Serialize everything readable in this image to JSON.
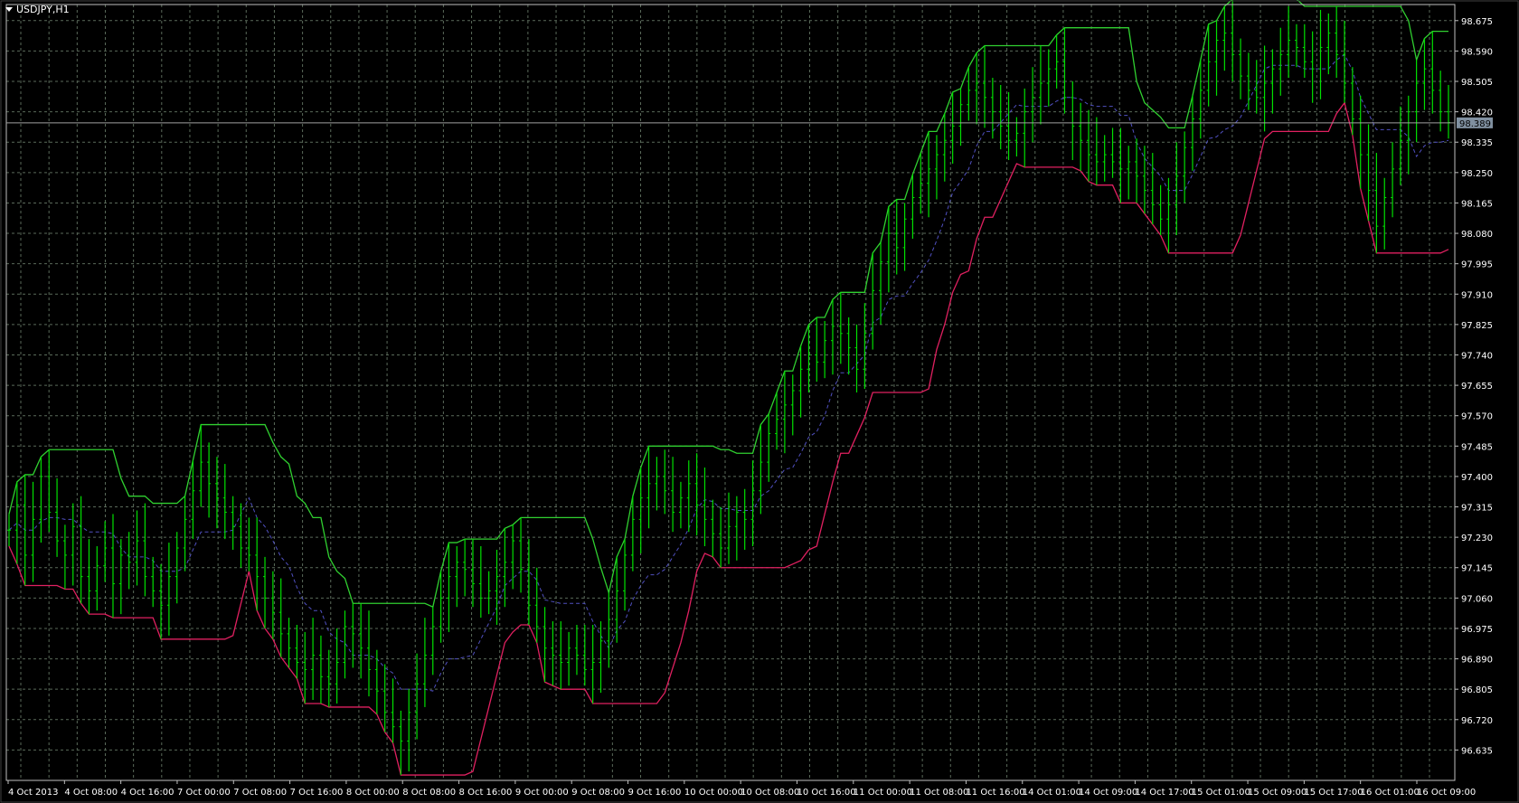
{
  "window": {
    "title": "USDJPY,H1"
  },
  "colors": {
    "background": "#000000",
    "grid": "#5a6a5a",
    "frame": "#c0c0c0",
    "bars": "#00e000",
    "upper_band": "#30d030",
    "lower_band": "#e02060",
    "middle_line": "#5050c0",
    "bid_line": "#a0a0a0",
    "price_tag_bg": "#8090a0"
  },
  "chart_data": {
    "type": "ohlc",
    "symbol": "USDJPY",
    "timeframe": "H1",
    "ylim": [
      96.55,
      98.72
    ],
    "current_price": 98.389,
    "current_price_label": "98.389",
    "y_ticks": [
      "98.675",
      "98.590",
      "98.505",
      "98.420",
      "98.335",
      "98.250",
      "98.165",
      "98.080",
      "97.995",
      "97.910",
      "97.825",
      "97.740",
      "97.655",
      "97.570",
      "97.485",
      "97.400",
      "97.315",
      "97.230",
      "97.145",
      "97.060",
      "96.975",
      "96.890",
      "96.805",
      "96.720",
      "96.635"
    ],
    "x_ticks": [
      "4 Oct 2013",
      "4 Oct 08:00",
      "4 Oct 16:00",
      "7 Oct 00:00",
      "7 Oct 08:00",
      "7 Oct 16:00",
      "8 Oct 00:00",
      "8 Oct 08:00",
      "8 Oct 16:00",
      "9 Oct 00:00",
      "9 Oct 08:00",
      "9 Oct 16:00",
      "10 Oct 00:00",
      "10 Oct 08:00",
      "10 Oct 16:00",
      "11 Oct 00:00",
      "11 Oct 08:00",
      "11 Oct 16:00",
      "14 Oct 01:00",
      "14 Oct 09:00",
      "14 Oct 17:00",
      "15 Oct 01:00",
      "15 Oct 09:00",
      "15 Oct 17:00",
      "16 Oct 01:00",
      "16 Oct 09:00"
    ],
    "close_path": [
      97.25,
      97.32,
      97.18,
      97.28,
      97.4,
      97.3,
      97.22,
      97.18,
      97.26,
      97.12,
      97.08,
      97.15,
      97.2,
      97.1,
      97.18,
      97.16,
      97.22,
      97.12,
      97.08,
      97.04,
      97.12,
      97.2,
      97.28,
      97.36,
      97.44,
      97.38,
      97.34,
      97.3,
      97.26,
      97.2,
      97.18,
      97.12,
      97.06,
      97.02,
      96.96,
      96.92,
      96.88,
      96.86,
      96.9,
      96.84,
      96.82,
      96.88,
      96.98,
      96.96,
      96.92,
      96.86,
      96.8,
      96.74,
      96.7,
      96.66,
      96.74,
      96.82,
      96.9,
      96.98,
      97.06,
      97.12,
      97.16,
      97.14,
      97.1,
      97.06,
      97.08,
      97.12,
      97.16,
      97.22,
      97.14,
      97.04,
      96.98,
      96.92,
      96.9,
      96.88,
      96.92,
      96.9,
      96.86,
      96.88,
      96.94,
      97.0,
      97.08,
      97.18,
      97.28,
      97.34,
      97.38,
      97.4,
      97.36,
      97.3,
      97.34,
      97.38,
      97.32,
      97.28,
      97.24,
      97.2,
      97.26,
      97.3,
      97.28,
      97.36,
      97.44,
      97.52,
      97.56,
      97.6,
      97.64,
      97.7,
      97.74,
      97.72,
      97.78,
      97.82,
      97.8,
      97.76,
      97.7,
      97.8,
      97.92,
      98.0,
      98.08,
      98.04,
      98.12,
      98.18,
      98.22,
      98.26,
      98.3,
      98.34,
      98.38,
      98.44,
      98.48,
      98.5,
      98.46,
      98.42,
      98.38,
      98.34,
      98.36,
      98.42,
      98.46,
      98.5,
      98.54,
      98.56,
      98.46,
      98.38,
      98.34,
      98.3,
      98.28,
      98.3,
      98.28,
      98.26,
      98.28,
      98.24,
      98.2,
      98.16,
      98.12,
      98.16,
      98.24,
      98.32,
      98.4,
      98.48,
      98.56,
      98.62,
      98.64,
      98.58,
      98.52,
      98.48,
      98.46,
      98.5,
      98.54,
      98.58,
      98.62,
      98.6,
      98.56,
      98.54,
      98.6,
      98.64,
      98.58,
      98.5,
      98.4,
      98.3,
      98.2,
      98.1,
      98.18,
      98.26,
      98.34,
      98.42,
      98.5,
      98.54,
      98.48,
      98.42,
      98.39
    ]
  }
}
